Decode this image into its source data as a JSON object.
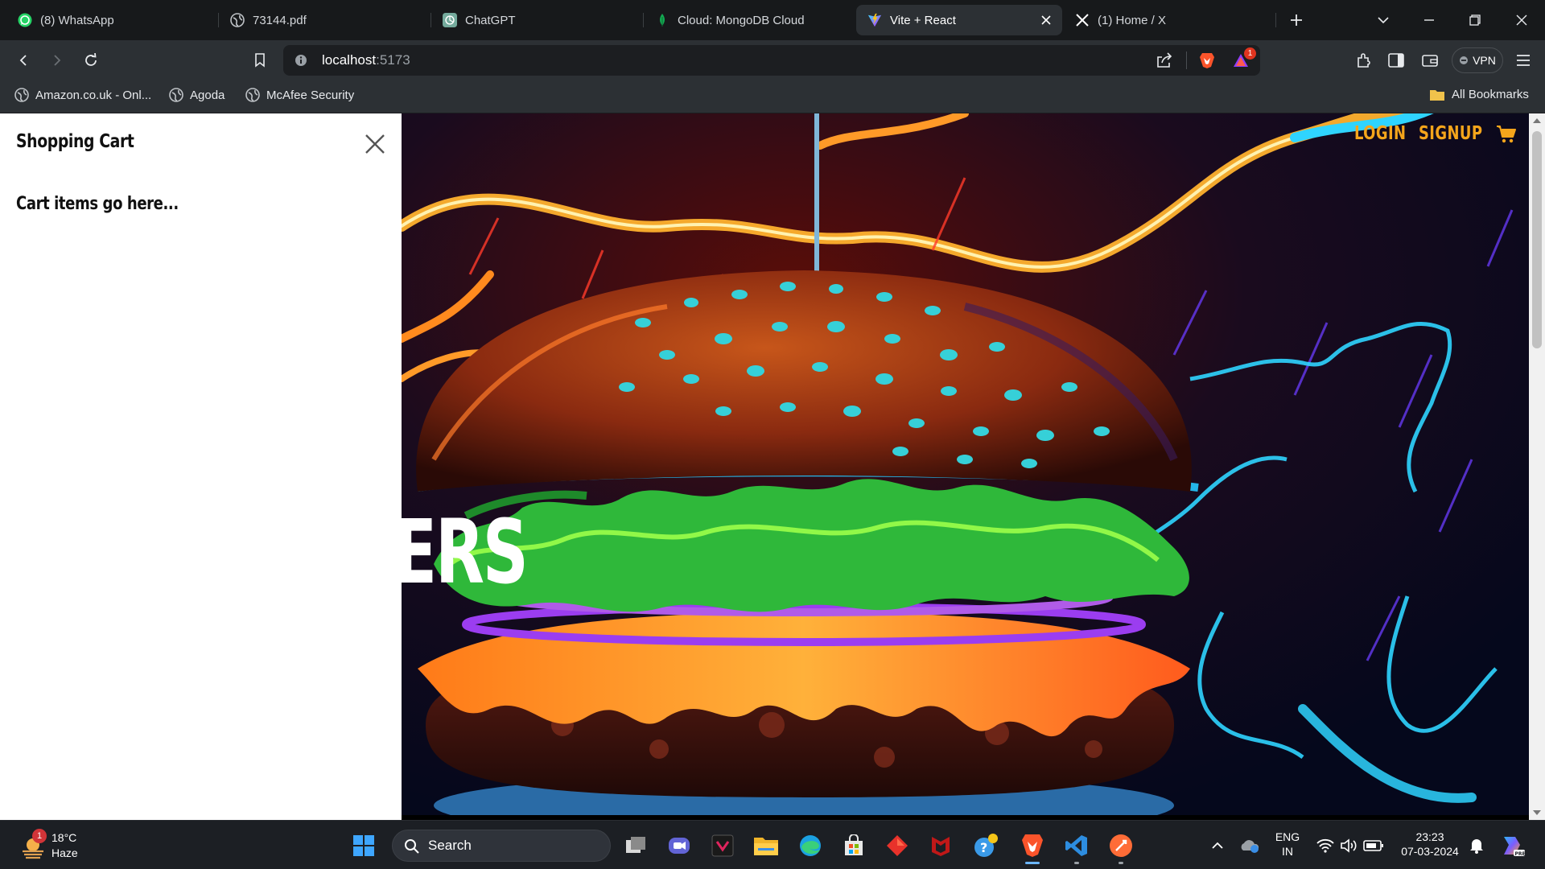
{
  "browser": {
    "tabs": [
      {
        "title": "(8) WhatsApp",
        "icon": "whatsapp-icon"
      },
      {
        "title": "73144.pdf",
        "icon": "globe-icon"
      },
      {
        "title": "ChatGPT",
        "icon": "chatgpt-icon"
      },
      {
        "title": "Cloud: MongoDB Cloud",
        "icon": "mongodb-leaf-icon"
      },
      {
        "title": "Vite + React",
        "icon": "vite-icon",
        "active": true
      },
      {
        "title": "(1) Home / X",
        "icon": "x-logo-icon"
      }
    ],
    "address": {
      "host": "localhost",
      "port": ":5173"
    },
    "brave_rewards_badge": "1",
    "vpn_label": "VPN",
    "bookmarks": [
      {
        "label": "Amazon.co.uk - Onl...",
        "icon": "globe-icon"
      },
      {
        "label": "Agoda",
        "icon": "globe-icon"
      },
      {
        "label": "McAfee Security",
        "icon": "globe-icon"
      }
    ],
    "all_bookmarks_label": "All Bookmarks"
  },
  "page": {
    "cart": {
      "title": "Shopping Cart",
      "placeholder": "Cart items go here..."
    },
    "nav": {
      "login": "LOGIN",
      "signup": "SIGNUP"
    },
    "hero_text": "ERS"
  },
  "taskbar": {
    "weather": {
      "temp": "18°C",
      "condition": "Haze",
      "badge": "1"
    },
    "search_label": "Search",
    "language": {
      "line1": "ENG",
      "line2": "IN"
    },
    "time": "23:23",
    "date": "07-03-2024"
  },
  "colors": {
    "accent_orange": "#f5a51b",
    "active_tab": "#2c3034",
    "taskbar": "#1c1f24"
  }
}
